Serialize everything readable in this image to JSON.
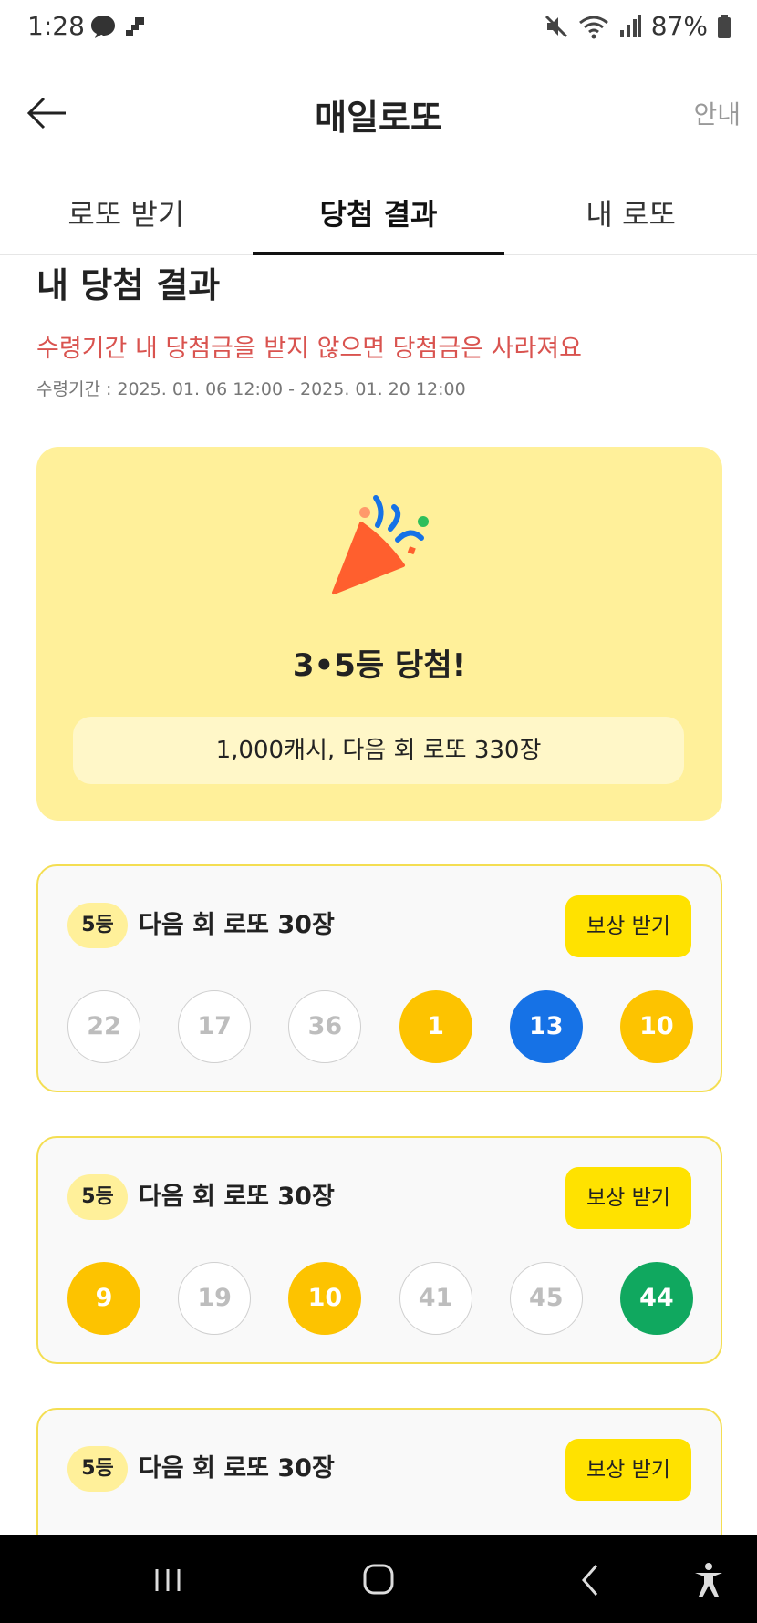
{
  "status": {
    "time": "1:28",
    "battery": "87%"
  },
  "header": {
    "title": "매일로또",
    "guide": "안내"
  },
  "tabs": [
    {
      "label": "로또 받기"
    },
    {
      "label": "당첨 결과"
    },
    {
      "label": "내 로또"
    }
  ],
  "section": {
    "title": "내 당첨 결과",
    "warning": "수령기간 내 당첨금을 받지 않으면 당첨금은 사라져요",
    "period": "수령기간 : 2025. 01. 06 12:00 - 2025. 01. 20 12:00"
  },
  "result": {
    "title": "3•5등 당첨!",
    "summary": "1,000캐시, 다음 회 로또 330장"
  },
  "prizes": [
    {
      "rank": "5등",
      "name": "다음 회 로또 30장",
      "button": "보상 받기",
      "balls": [
        {
          "n": "22",
          "c": "plain"
        },
        {
          "n": "17",
          "c": "plain"
        },
        {
          "n": "36",
          "c": "plain"
        },
        {
          "n": "1",
          "c": "yellow"
        },
        {
          "n": "13",
          "c": "blue"
        },
        {
          "n": "10",
          "c": "yellow"
        }
      ]
    },
    {
      "rank": "5등",
      "name": "다음 회 로또 30장",
      "button": "보상 받기",
      "balls": [
        {
          "n": "9",
          "c": "yellow"
        },
        {
          "n": "19",
          "c": "plain"
        },
        {
          "n": "10",
          "c": "yellow"
        },
        {
          "n": "41",
          "c": "plain"
        },
        {
          "n": "45",
          "c": "plain"
        },
        {
          "n": "44",
          "c": "green"
        }
      ]
    },
    {
      "rank": "5등",
      "name": "다음 회 로또 30장",
      "button": "보상 받기",
      "balls": []
    }
  ],
  "colors": {
    "accent": "#ffe200",
    "card": "#fff09a",
    "warning": "#d9534f",
    "ball_yellow": "#fdc300",
    "ball_blue": "#1672e6",
    "ball_green": "#10a85f"
  },
  "icons": [
    "chat-bubble-icon",
    "mute-icon",
    "wifi-icon",
    "signal-icon",
    "battery-icon",
    "back-arrow-icon",
    "party-popper-icon",
    "recents-icon",
    "home-icon",
    "nav-back-icon",
    "accessibility-icon"
  ]
}
